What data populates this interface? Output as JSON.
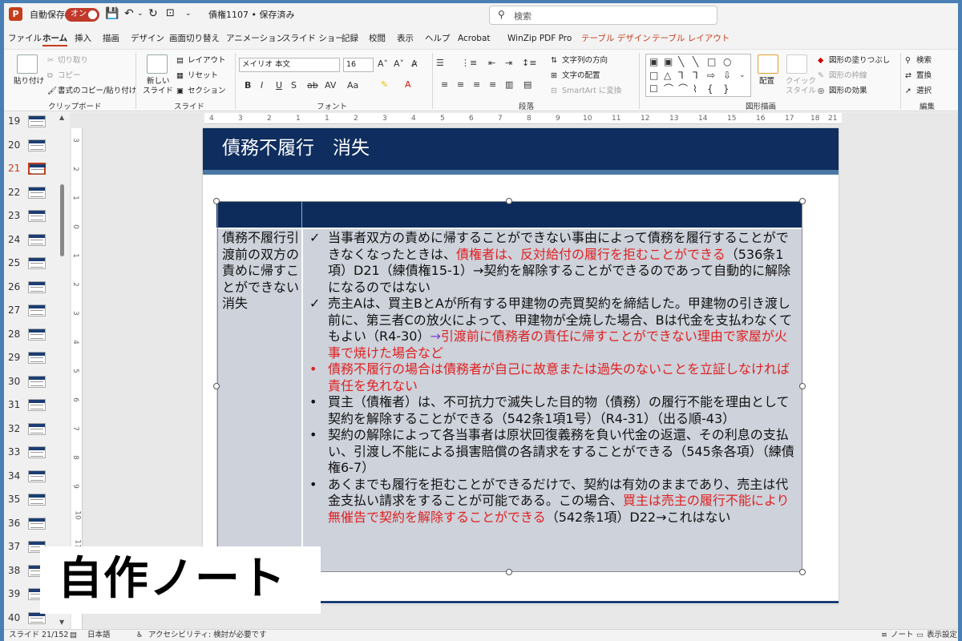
{
  "titlebar": {
    "autosave_label": "自動保存",
    "autosave_state": "オン",
    "doc_title": "債権1107 • 保存済み",
    "search_placeholder": "検索"
  },
  "menu": {
    "tabs": [
      "ファイル",
      "ホーム",
      "挿入",
      "描画",
      "デザイン",
      "画面切り替え",
      "アニメーション",
      "スライド ショー",
      "記録",
      "校閲",
      "表示",
      "ヘルプ",
      "Acrobat",
      "WinZip PDF Pro",
      "テーブル デザイン",
      "テーブル レイアウト"
    ],
    "active_tab": "ホーム"
  },
  "ribbon": {
    "clipboard": {
      "paste": "貼り付け",
      "cut": "切り取り",
      "copy": "コピー",
      "format_painter": "書式のコピー/貼り付け",
      "group": "クリップボード"
    },
    "slides": {
      "new_slide_1": "新しい",
      "new_slide_2": "スライド",
      "layout": "レイアウト",
      "reset": "リセット",
      "section": "セクション",
      "group": "スライド"
    },
    "font": {
      "font_name": "メイリオ 本文",
      "font_size": "16",
      "group": "フォント"
    },
    "paragraph": {
      "text_direction": "文字列の方向",
      "align_text": "文字の配置",
      "smartart": "SmartArt に変換",
      "group": "段落"
    },
    "drawing": {
      "arrange": "配置",
      "quick_style_1": "クイック",
      "quick_style_2": "スタイル",
      "shape_fill": "図形の塗りつぶし",
      "shape_outline": "図形の枠線",
      "shape_effects": "図形の効果",
      "group": "図形描画"
    },
    "editing": {
      "find": "検索",
      "replace": "置換",
      "select": "選択",
      "group": "編集"
    }
  },
  "thumbnails": {
    "numbers": [
      "19",
      "20",
      "21",
      "22",
      "23",
      "24",
      "25",
      "26",
      "27",
      "28",
      "29",
      "30",
      "31",
      "32",
      "33",
      "34",
      "35",
      "36",
      "37",
      "38",
      "39",
      "40"
    ],
    "selected": "21"
  },
  "slide": {
    "title": "債務不履行　消失",
    "row_label": "債務不履行引渡前の双方の責めに帰すことができない消失",
    "bullets": [
      {
        "marker": "✓",
        "parts": [
          {
            "text": "当事者双方の責めに帰することができない事由によって債務を履行することができなくなったときは、",
            "style": "normal"
          },
          {
            "text": "債権者は、反対給付の履行を拒むことができる",
            "style": "red"
          },
          {
            "text": "（536条1項）D21（練債権15-1）→契約を解除することができるのであって自動的に解除になるのではない",
            "style": "normal"
          }
        ]
      },
      {
        "marker": "✓",
        "parts": [
          {
            "text": "売主Aは、買主BとAが所有する甲建物の売買契約を締結した。甲建物の引き渡し前に、第三者Cの放火によって、甲建物が全焼した場合、Bは代金を支払わなくてもよい（R4-30）",
            "style": "normal"
          },
          {
            "text": "→",
            "style": "purple"
          },
          {
            "text": "引渡前に債務者の責任に帰すことができない理由で家屋が火事で焼けた場合など",
            "style": "red"
          }
        ]
      },
      {
        "marker": "•",
        "red_marker": true,
        "parts": [
          {
            "text": "債務不履行の場合は債務者が自己に故意または過失のないことを立証しなければ責任を免れない",
            "style": "red"
          }
        ]
      },
      {
        "marker": "•",
        "parts": [
          {
            "text": "買主（債権者）は、不可抗力で滅失した目的物（債務）の履行不能を理由として契約を解除することができる（542条1項1号）（R4-31）（出る順-43）",
            "style": "normal"
          }
        ]
      },
      {
        "marker": "•",
        "parts": [
          {
            "text": "契約の解除によって各当事者は原状回復義務を負い代金の返還、その利息の支払い、引渡し不能による損害賠償の各請求をすることができる（545条各項）（練債権6-7）",
            "style": "normal"
          }
        ]
      },
      {
        "marker": "•",
        "parts": [
          {
            "text": "あくまでも履行を拒むことができるだけで、契約は有効のままであり、売主は代金支払い請求をすることが可能である。この場合、",
            "style": "normal"
          },
          {
            "text": "買主は売主の履行不能により無催告で契約を解除することができる",
            "style": "red"
          },
          {
            "text": "（542条1項）D22→これはない",
            "style": "normal"
          }
        ]
      }
    ]
  },
  "overlay": {
    "badge": "自作ノート"
  },
  "statusbar": {
    "slide_counter": "スライド 21/152",
    "language": "日本語",
    "accessibility": "アクセシビリティ: 検討が必要です",
    "notes": "ノート",
    "display_settings": "表示設定"
  },
  "colors": {
    "accent": "#c43e1c",
    "slide_header": "#0f2d5e",
    "table_body": "#cdd2db",
    "highlight_red": "#e02020"
  }
}
